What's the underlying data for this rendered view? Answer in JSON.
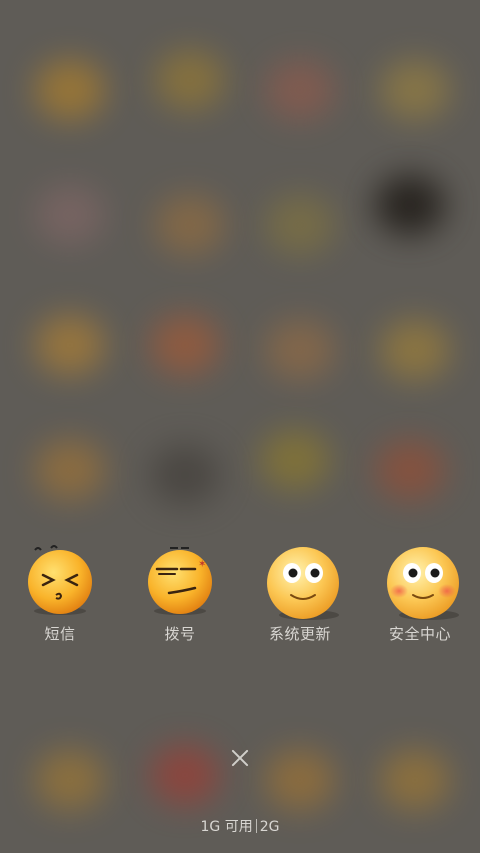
{
  "apps": [
    {
      "label": "短信",
      "icon": "squinting-face-icon"
    },
    {
      "label": "拨号",
      "icon": "annoyed-face-icon"
    },
    {
      "label": "系统更新",
      "icon": "smiling-face-icon"
    },
    {
      "label": "安全中心",
      "icon": "blushing-face-icon"
    }
  ],
  "memory": {
    "free": "1G 可用",
    "total": "2G"
  },
  "colors": {
    "background": "#5f5c57",
    "face_yellow": "#f7b52a",
    "text": "#d8d6d2"
  }
}
